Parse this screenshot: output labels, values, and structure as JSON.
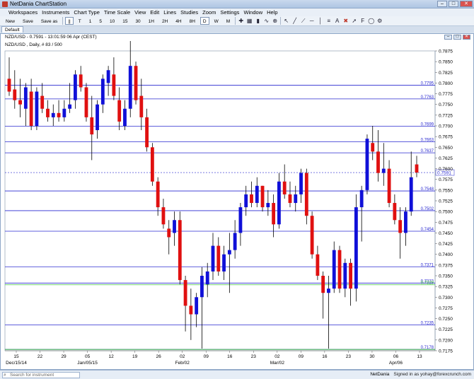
{
  "window": {
    "title": "NetDania ChartStation",
    "min": "–",
    "max": "□",
    "close": "✕"
  },
  "menu": [
    "Workspaces",
    "Instruments",
    "Chart Type",
    "Time Scale",
    "View",
    "Edit",
    "Lines",
    "Studies",
    "Zoom",
    "Settings",
    "Window",
    "Help"
  ],
  "toolbar": {
    "new": "New",
    "save": "Save",
    "save_as": "Save as",
    "buttons": [
      "||",
      "T",
      "1",
      "5",
      "10",
      "15",
      "30",
      "1H",
      "2H",
      "4H",
      "8H",
      "D",
      "W",
      "M"
    ],
    "active": "D"
  },
  "tab": "Default",
  "chart": {
    "header": "NZD/USD - 0.7591 - 13:01:59  06 Apr (CEST)",
    "sub": "NZD/USD , Daily, # 83 / 500",
    "current_price": "0.7591",
    "current_level": 0.7591
  },
  "chart_data": {
    "type": "candlestick",
    "y_axis": {
      "min": 0.7175,
      "max": 0.7875,
      "step": 0.0025,
      "ticks": [
        "0.7875",
        "0.7850",
        "0.7825",
        "0.7800",
        "0.7775",
        "0.7750",
        "0.7725",
        "0.7700",
        "0.7675",
        "0.7650",
        "0.7625",
        "0.7600",
        "0.7575",
        "0.7550",
        "0.7525",
        "0.7500",
        "0.7475",
        "0.7450",
        "0.7425",
        "0.7400",
        "0.7375",
        "0.7350",
        "0.7325",
        "0.7300",
        "0.7275",
        "0.7250",
        "0.7225",
        "0.7200",
        "0.7175"
      ]
    },
    "x_axis": {
      "ticks": [
        "15",
        "22",
        "29",
        "05",
        "12",
        "19",
        "26",
        "02",
        "09",
        "16",
        "23",
        "02",
        "09",
        "16",
        "23",
        "30",
        "06",
        "13"
      ],
      "month_labels": [
        {
          "label": "Dec/15/14",
          "at": "15"
        },
        {
          "label": "Jan/05/15",
          "at": "05"
        },
        {
          "label": "Feb/02",
          "at": "02"
        },
        {
          "label": "Mar/02",
          "at": "02"
        },
        {
          "label": "Apr/06",
          "at": "06"
        }
      ]
    },
    "horizontal_lines": [
      {
        "value": 0.7795,
        "label": "0.7795",
        "color": "#2a2ad0"
      },
      {
        "value": 0.7763,
        "label": "0.7763",
        "color": "#2a2ad0"
      },
      {
        "value": 0.7699,
        "label": "0.7699",
        "color": "#2a2ad0"
      },
      {
        "value": 0.7663,
        "label": "0.7663",
        "color": "#2a2ad0"
      },
      {
        "value": 0.7637,
        "label": "0.7637",
        "color": "#2a2ad0"
      },
      {
        "value": 0.7548,
        "label": "0.7548",
        "color": "#2a2ad0"
      },
      {
        "value": 0.7502,
        "label": "0.7502",
        "color": "#2a2ad0"
      },
      {
        "value": 0.7454,
        "label": "0.7454",
        "color": "#2a2ad0"
      },
      {
        "value": 0.7371,
        "label": "0.7371",
        "color": "#2a2ad0"
      },
      {
        "value": 0.7333,
        "label": "0.7333",
        "color": "#2a2ad0"
      },
      {
        "value": 0.7329,
        "label": "0.7329",
        "color": "#3cbf3c"
      },
      {
        "value": 0.7235,
        "label": "0.7235",
        "color": "#2a2ad0"
      },
      {
        "value": 0.7178,
        "label": "0.7178",
        "color": "#2a2ad0"
      },
      {
        "value": 0.7178,
        "label": "",
        "color": "#3cbf3c"
      }
    ],
    "candles": [
      {
        "o": 0.781,
        "h": 0.786,
        "l": 0.777,
        "c": 0.778
      },
      {
        "o": 0.7785,
        "h": 0.783,
        "l": 0.774,
        "c": 0.776
      },
      {
        "o": 0.776,
        "h": 0.781,
        "l": 0.772,
        "c": 0.775
      },
      {
        "o": 0.774,
        "h": 0.78,
        "l": 0.77,
        "c": 0.779
      },
      {
        "o": 0.778,
        "h": 0.781,
        "l": 0.769,
        "c": 0.77
      },
      {
        "o": 0.77,
        "h": 0.779,
        "l": 0.769,
        "c": 0.778
      },
      {
        "o": 0.777,
        "h": 0.78,
        "l": 0.773,
        "c": 0.774
      },
      {
        "o": 0.774,
        "h": 0.776,
        "l": 0.771,
        "c": 0.772
      },
      {
        "o": 0.772,
        "h": 0.775,
        "l": 0.77,
        "c": 0.773
      },
      {
        "o": 0.773,
        "h": 0.776,
        "l": 0.771,
        "c": 0.772
      },
      {
        "o": 0.772,
        "h": 0.776,
        "l": 0.771,
        "c": 0.774
      },
      {
        "o": 0.774,
        "h": 0.78,
        "l": 0.773,
        "c": 0.775
      },
      {
        "o": 0.776,
        "h": 0.783,
        "l": 0.774,
        "c": 0.782
      },
      {
        "o": 0.782,
        "h": 0.784,
        "l": 0.778,
        "c": 0.779
      },
      {
        "o": 0.779,
        "h": 0.78,
        "l": 0.771,
        "c": 0.772
      },
      {
        "o": 0.772,
        "h": 0.777,
        "l": 0.762,
        "c": 0.768
      },
      {
        "o": 0.769,
        "h": 0.776,
        "l": 0.767,
        "c": 0.775
      },
      {
        "o": 0.775,
        "h": 0.782,
        "l": 0.773,
        "c": 0.781
      },
      {
        "o": 0.78,
        "h": 0.784,
        "l": 0.777,
        "c": 0.783
      },
      {
        "o": 0.782,
        "h": 0.786,
        "l": 0.776,
        "c": 0.777
      },
      {
        "o": 0.776,
        "h": 0.779,
        "l": 0.769,
        "c": 0.771
      },
      {
        "o": 0.77,
        "h": 0.776,
        "l": 0.769,
        "c": 0.774
      },
      {
        "o": 0.774,
        "h": 0.79,
        "l": 0.772,
        "c": 0.784
      },
      {
        "o": 0.784,
        "h": 0.785,
        "l": 0.775,
        "c": 0.776
      },
      {
        "o": 0.777,
        "h": 0.781,
        "l": 0.769,
        "c": 0.772
      },
      {
        "o": 0.772,
        "h": 0.774,
        "l": 0.764,
        "c": 0.765
      },
      {
        "o": 0.765,
        "h": 0.766,
        "l": 0.756,
        "c": 0.757
      },
      {
        "o": 0.757,
        "h": 0.758,
        "l": 0.749,
        "c": 0.751
      },
      {
        "o": 0.751,
        "h": 0.753,
        "l": 0.746,
        "c": 0.747
      },
      {
        "o": 0.746,
        "h": 0.748,
        "l": 0.74,
        "c": 0.744
      },
      {
        "o": 0.745,
        "h": 0.75,
        "l": 0.742,
        "c": 0.748
      },
      {
        "o": 0.748,
        "h": 0.75,
        "l": 0.733,
        "c": 0.734
      },
      {
        "o": 0.734,
        "h": 0.735,
        "l": 0.722,
        "c": 0.728
      },
      {
        "o": 0.728,
        "h": 0.732,
        "l": 0.72,
        "c": 0.726
      },
      {
        "o": 0.726,
        "h": 0.731,
        "l": 0.723,
        "c": 0.73
      },
      {
        "o": 0.73,
        "h": 0.737,
        "l": 0.718,
        "c": 0.735
      },
      {
        "o": 0.733,
        "h": 0.738,
        "l": 0.73,
        "c": 0.736
      },
      {
        "o": 0.736,
        "h": 0.745,
        "l": 0.734,
        "c": 0.742
      },
      {
        "o": 0.742,
        "h": 0.744,
        "l": 0.735,
        "c": 0.736
      },
      {
        "o": 0.736,
        "h": 0.742,
        "l": 0.734,
        "c": 0.74
      },
      {
        "o": 0.74,
        "h": 0.745,
        "l": 0.731,
        "c": 0.741
      },
      {
        "o": 0.741,
        "h": 0.748,
        "l": 0.739,
        "c": 0.745
      },
      {
        "o": 0.745,
        "h": 0.752,
        "l": 0.742,
        "c": 0.751
      },
      {
        "o": 0.751,
        "h": 0.756,
        "l": 0.749,
        "c": 0.754
      },
      {
        "o": 0.754,
        "h": 0.757,
        "l": 0.751,
        "c": 0.752
      },
      {
        "o": 0.752,
        "h": 0.758,
        "l": 0.751,
        "c": 0.756
      },
      {
        "o": 0.756,
        "h": 0.756,
        "l": 0.75,
        "c": 0.751
      },
      {
        "o": 0.751,
        "h": 0.755,
        "l": 0.749,
        "c": 0.752
      },
      {
        "o": 0.752,
        "h": 0.754,
        "l": 0.744,
        "c": 0.747
      },
      {
        "o": 0.747,
        "h": 0.759,
        "l": 0.746,
        "c": 0.757
      },
      {
        "o": 0.757,
        "h": 0.761,
        "l": 0.753,
        "c": 0.754
      },
      {
        "o": 0.754,
        "h": 0.757,
        "l": 0.751,
        "c": 0.752
      },
      {
        "o": 0.752,
        "h": 0.756,
        "l": 0.75,
        "c": 0.754
      },
      {
        "o": 0.754,
        "h": 0.76,
        "l": 0.752,
        "c": 0.759
      },
      {
        "o": 0.759,
        "h": 0.76,
        "l": 0.747,
        "c": 0.749
      },
      {
        "o": 0.749,
        "h": 0.75,
        "l": 0.739,
        "c": 0.74
      },
      {
        "o": 0.74,
        "h": 0.742,
        "l": 0.734,
        "c": 0.735
      },
      {
        "o": 0.735,
        "h": 0.736,
        "l": 0.725,
        "c": 0.731
      },
      {
        "o": 0.731,
        "h": 0.735,
        "l": 0.718,
        "c": 0.732
      },
      {
        "o": 0.732,
        "h": 0.743,
        "l": 0.731,
        "c": 0.741
      },
      {
        "o": 0.741,
        "h": 0.742,
        "l": 0.731,
        "c": 0.732
      },
      {
        "o": 0.732,
        "h": 0.739,
        "l": 0.73,
        "c": 0.738
      },
      {
        "o": 0.738,
        "h": 0.739,
        "l": 0.728,
        "c": 0.732
      },
      {
        "o": 0.732,
        "h": 0.754,
        "l": 0.729,
        "c": 0.751
      },
      {
        "o": 0.751,
        "h": 0.756,
        "l": 0.743,
        "c": 0.755
      },
      {
        "o": 0.755,
        "h": 0.768,
        "l": 0.754,
        "c": 0.767
      },
      {
        "o": 0.766,
        "h": 0.77,
        "l": 0.762,
        "c": 0.764
      },
      {
        "o": 0.764,
        "h": 0.769,
        "l": 0.757,
        "c": 0.759
      },
      {
        "o": 0.759,
        "h": 0.766,
        "l": 0.756,
        "c": 0.76
      },
      {
        "o": 0.76,
        "h": 0.762,
        "l": 0.751,
        "c": 0.752
      },
      {
        "o": 0.752,
        "h": 0.754,
        "l": 0.747,
        "c": 0.748
      },
      {
        "o": 0.748,
        "h": 0.751,
        "l": 0.739,
        "c": 0.745
      },
      {
        "o": 0.745,
        "h": 0.751,
        "l": 0.742,
        "c": 0.75
      },
      {
        "o": 0.75,
        "h": 0.764,
        "l": 0.749,
        "c": 0.758
      },
      {
        "o": 0.761,
        "h": 0.763,
        "l": 0.758,
        "c": 0.7591
      }
    ],
    "up_color": "#1010d8",
    "down_color": "#e01010"
  },
  "status": {
    "search_placeholder": "Search for instrument",
    "provider": "NetDania",
    "signed_in": "Signed in as yohay@forexcrunch.com"
  }
}
